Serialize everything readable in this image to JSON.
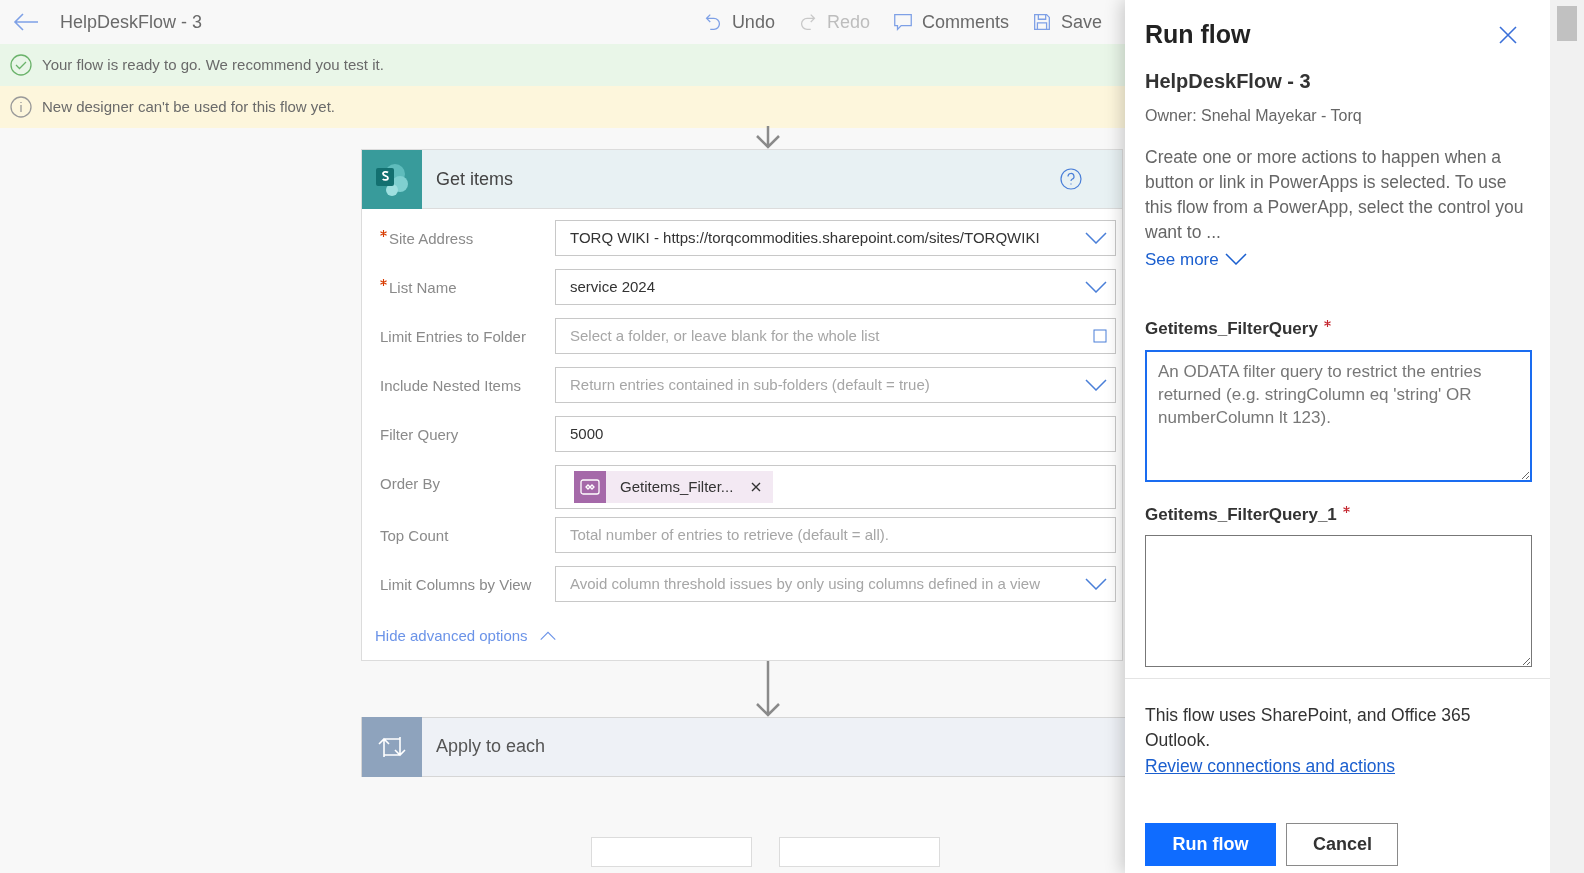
{
  "header": {
    "title": "HelpDeskFlow - 3",
    "actions": [
      {
        "kind": "undo",
        "label": "Undo",
        "disabled": false
      },
      {
        "kind": "redo",
        "label": "Redo",
        "disabled": true
      },
      {
        "kind": "comments",
        "label": "Comments",
        "disabled": false
      },
      {
        "kind": "save",
        "label": "Save",
        "disabled": false
      }
    ]
  },
  "banners": [
    {
      "kind": "success",
      "text": "Your flow is ready to go. We recommend you test it."
    },
    {
      "kind": "info",
      "text": "New designer can't be used for this flow yet."
    }
  ],
  "get_items_card": {
    "title": "Get items",
    "fields": [
      {
        "label": "Site Address",
        "required": true,
        "kind": "dropdown",
        "value": "TORQ WIKI - https://torqcommodities.sharepoint.com/sites/TORQWIKI"
      },
      {
        "label": "List Name",
        "required": true,
        "kind": "dropdown",
        "value": "service 2024"
      },
      {
        "label": "Limit Entries to Folder",
        "required": false,
        "kind": "folder",
        "placeholder": "Select a folder, or leave blank for the whole list"
      },
      {
        "label": "Include Nested Items",
        "required": false,
        "kind": "dropdown",
        "placeholder": "Return entries contained in sub-folders (default = true)"
      },
      {
        "label": "Filter Query",
        "required": false,
        "kind": "text",
        "value": "5000"
      },
      {
        "label": "Order By",
        "required": false,
        "kind": "token",
        "token": "Getitems_Filter..."
      },
      {
        "label": "Top Count",
        "required": false,
        "kind": "text",
        "placeholder": "Total number of entries to retrieve (default = all)."
      },
      {
        "label": "Limit Columns by View",
        "required": false,
        "kind": "dropdown",
        "placeholder": "Avoid column threshold issues by only using columns defined in a view"
      }
    ],
    "advanced_link": "Hide advanced options"
  },
  "apply_card": {
    "title": "Apply to each"
  },
  "run_panel": {
    "title": "Run flow",
    "flow_name": "HelpDeskFlow - 3",
    "owner": "Owner: Snehal Mayekar - Torq",
    "description": "Create one or more actions to happen when a button or link in PowerApps is selected. To use this flow from a PowerApp, select the control you want to ...",
    "see_more": "See more",
    "inputs": [
      {
        "label": "Getitems_FilterQuery",
        "required": true,
        "focused": true,
        "placeholder": "An ODATA filter query to restrict the entries returned (e.g. stringColumn eq 'string' OR numberColumn lt 123)."
      },
      {
        "label": "Getitems_FilterQuery_1",
        "required": true,
        "focused": false
      }
    ],
    "connections_note": "This flow uses SharePoint, and Office 365 Outlook.",
    "connections_link": "Review connections and actions",
    "buttons": [
      {
        "label": "Run flow",
        "kind": "primary"
      },
      {
        "label": "Cancel",
        "kind": "secondary"
      }
    ]
  }
}
